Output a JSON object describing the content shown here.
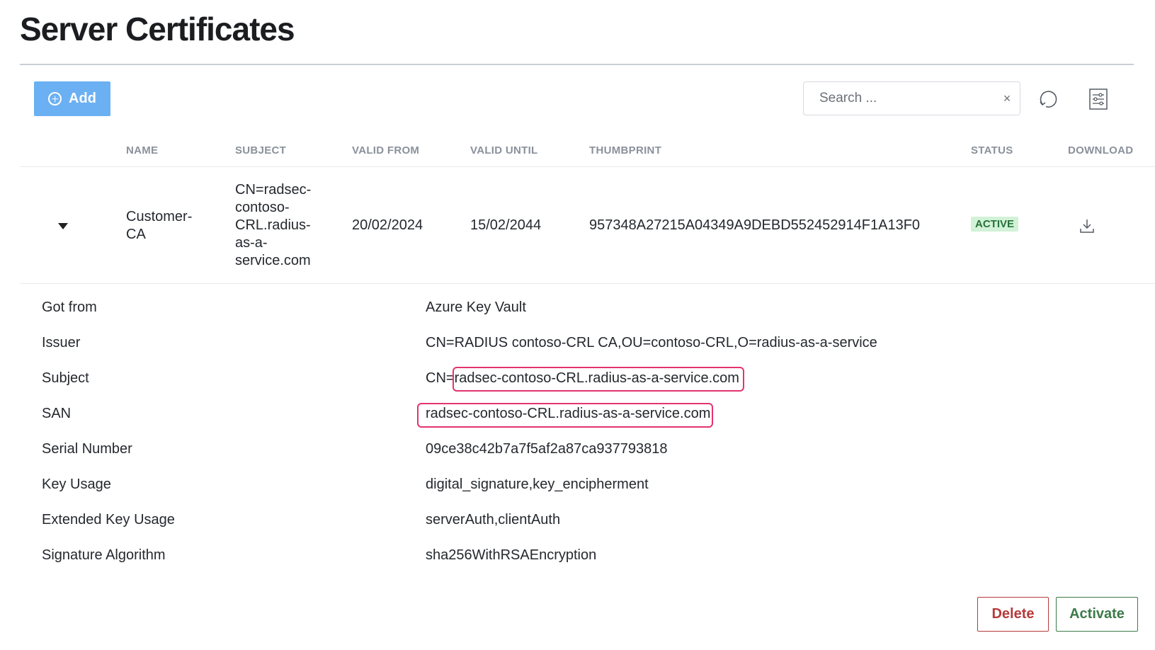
{
  "page": {
    "title": "Server Certificates"
  },
  "toolbar": {
    "add_label": "Add",
    "search_placeholder": "Search ...",
    "clear_symbol": "×",
    "icons": [
      "plus-circle-icon",
      "close-icon",
      "refresh-icon",
      "column-settings-icon"
    ]
  },
  "table": {
    "headers": {
      "name": "NAME",
      "subject": "SUBJECT",
      "valid_from": "VALID FROM",
      "valid_until": "VALID UNTIL",
      "thumbprint": "THUMBPRINT",
      "status": "STATUS",
      "download": "DOWNLOAD"
    },
    "rows": [
      {
        "name_line1": "Customer-",
        "name_line2": "CA",
        "subject_lines": [
          "CN=radsec-",
          "contoso-",
          "CRL.radius-",
          "as-a-",
          "service.com"
        ],
        "valid_from": "20/02/2024",
        "valid_until": "15/02/2044",
        "thumbprint": "957348A27215A04349A9DEBD552452914F1A13F0",
        "status": "ACTIVE",
        "expanded": true
      }
    ]
  },
  "details": {
    "got_from": {
      "label": "Got from",
      "value": "Azure Key Vault"
    },
    "issuer": {
      "label": "Issuer",
      "value": "CN=RADIUS contoso-CRL CA,OU=contoso-CRL,O=radius-as-a-service"
    },
    "subject": {
      "label": "Subject",
      "prefix": "CN=",
      "value": "radsec-contoso-CRL.radius-as-a-service.com"
    },
    "san": {
      "label": "SAN",
      "value": "radsec-contoso-CRL.radius-as-a-service.com"
    },
    "serial": {
      "label": "Serial Number",
      "value": "09ce38c42b7a7f5af2a87ca937793818"
    },
    "key_usage": {
      "label": "Key Usage",
      "value": "digital_signature,key_encipherment"
    },
    "ext_key_usage": {
      "label": "Extended Key Usage",
      "value": "serverAuth,clientAuth"
    },
    "sig_alg": {
      "label": "Signature Algorithm",
      "value": "sha256WithRSAEncryption"
    }
  },
  "actions": {
    "delete_label": "Delete",
    "activate_label": "Activate"
  },
  "colors": {
    "primary": "#6bb0f2",
    "highlight": "#e5336e",
    "active_badge_bg": "#d2f2d8",
    "active_badge_text": "#27723a",
    "danger": "#b63a3a",
    "success": "#3c7a48"
  }
}
